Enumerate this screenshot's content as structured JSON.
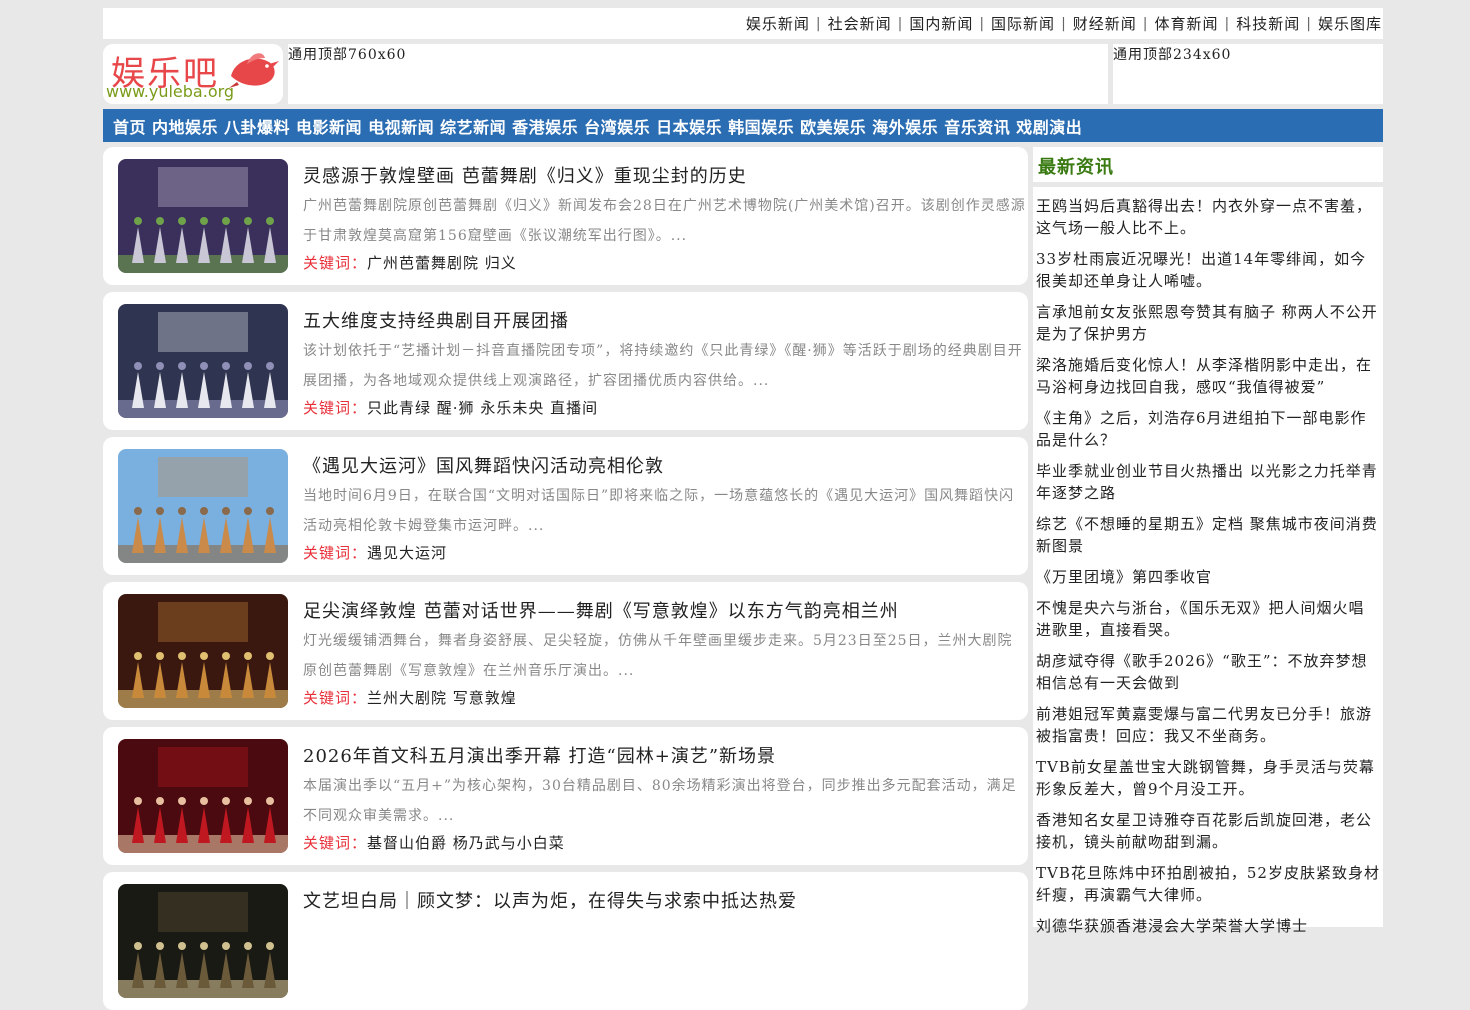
{
  "topnav": {
    "links": [
      "娱乐新闻",
      "社会新闻",
      "国内新闻",
      "国际新闻",
      "财经新闻",
      "体育新闻",
      "科技新闻",
      "娱乐图库"
    ]
  },
  "logo": {
    "name": "娱乐吧",
    "url": "www.yuleba.org"
  },
  "ads": {
    "ad1": "通用顶部760x60",
    "ad2": "通用顶部234x60"
  },
  "catnav": {
    "items": [
      "首页",
      "内地娱乐",
      "八卦爆料",
      "电影新闻",
      "电视新闻",
      "综艺新闻",
      "香港娱乐",
      "台湾娱乐",
      "日本娱乐",
      "韩国娱乐",
      "欧美娱乐",
      "海外娱乐",
      "音乐资讯",
      "戏剧演出"
    ]
  },
  "articles": [
    {
      "title": "灵感源于敦煌壁画 芭蕾舞剧《归义》重现尘封的历史",
      "summary": "广州芭蕾舞剧院原创芭蕾舞剧《归义》新闻发布会28日在广州艺术博物院(广州美术馆)召开。该剧创作灵感源于甘肃敦煌莫高窟第156窟壁画《张议潮统军出行图》。...",
      "kw_label": "关键词：",
      "keywords": "广州芭蕾舞剧院 归义"
    },
    {
      "title": "五大维度支持经典剧目开展团播",
      "summary": "该计划依托于“艺播计划－抖音直播院团专项”，将持续邀约《只此青绿》《醒·狮》等活跃于剧场的经典剧目开展团播，为各地域观众提供线上观演路径，扩容团播优质内容供给。...",
      "kw_label": "关键词：",
      "keywords": "只此青绿 醒·狮 永乐未央 直播间"
    },
    {
      "title": "《遇见大运河》国风舞蹈快闪活动亮相伦敦",
      "summary": "当地时间6月9日，在联合国“文明对话国际日”即将来临之际，一场意蕴悠长的《遇见大运河》国风舞蹈快闪活动亮相伦敦卡姆登集市运河畔。...",
      "kw_label": "关键词：",
      "keywords": "遇见大运河"
    },
    {
      "title": "足尖演绎敦煌 芭蕾对话世界——舞剧《写意敦煌》以东方气韵亮相兰州",
      "summary": "灯光缓缓铺洒舞台，舞者身姿舒展、足尖轻旋，仿佛从千年壁画里缓步走来。5月23日至25日，兰州大剧院原创芭蕾舞剧《写意敦煌》在兰州音乐厅演出。...",
      "kw_label": "关键词：",
      "keywords": "兰州大剧院 写意敦煌"
    },
    {
      "title": "2026年首文科五月演出季开幕 打造“园林+演艺”新场景",
      "summary": "本届演出季以“五月+”为核心架构，30台精品剧目、80余场精彩演出将登台，同步推出多元配套活动，满足不同观众审美需求。...",
      "kw_label": "关键词：",
      "keywords": "基督山伯爵 杨乃武与小白菜"
    },
    {
      "title": "文艺坦白局｜顾文梦：以声为炬，在得失与求索中抵达热爱",
      "summary": "",
      "kw_label": "",
      "keywords": ""
    }
  ],
  "sidebar": {
    "title": "最新资讯",
    "items": [
      "王鸥当妈后真豁得出去！内衣外穿一点不害羞，这气场一般人比不上。",
      "33岁杜雨宸近况曝光！出道14年零绯闻，如今很美却还单身让人唏嘘。",
      "言承旭前女友张熙恩夸赞其有脑子 称两人不公开是为了保护男方",
      "梁洛施婚后变化惊人！从李泽楷阴影中走出，在马浴柯身边找回自我，感叹“我值得被爱”",
      "《主角》之后，刘浩存6月进组拍下一部电影作品是什么？",
      "毕业季就业创业节目火热播出 以光影之力托举青年逐梦之路",
      "综艺《不想睡的星期五》定档 聚焦城市夜间消费新图景",
      "《万里团境》第四季收官",
      "不愧是央六与浙台，《国乐无双》把人间烟火唱进歌里，直接看哭。",
      "胡彦斌夺得《歌手2026》“歌王”：不放弃梦想 相信总有一天会做到",
      "前港姐冠军黄嘉雯爆与富二代男友已分手！旅游被指富贵！回应：我又不坐商务。",
      "TVB前女星盖世宝大跳钢管舞，身手灵活与荧幕形象反差大，曾9个月没工开。",
      "香港知名女星卫诗雅夺百花影后凯旋回港，老公接机，镜头前献吻甜到漏。",
      "TVB花旦陈炜中环拍剧被拍，52岁皮肤紧致身材纤瘦，再演霸气大律师。",
      "刘德华获颁香港浸会大学荣誉大学博士"
    ]
  }
}
